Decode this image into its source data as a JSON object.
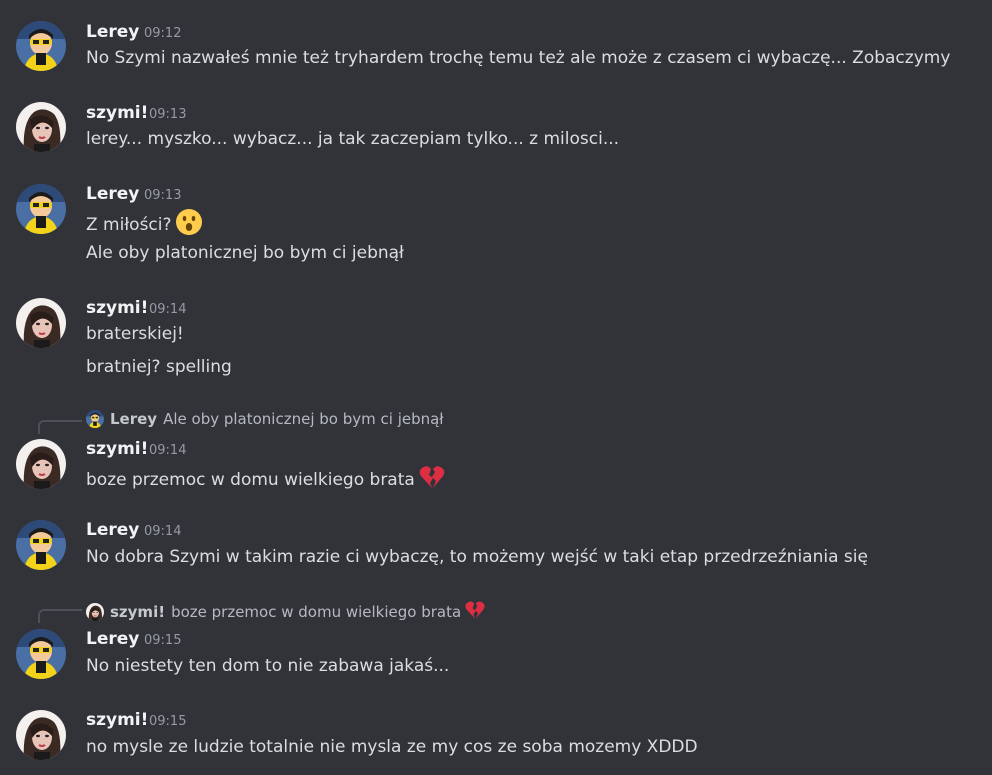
{
  "messages": [
    {
      "author": "Lerey",
      "time": "09:12",
      "avatar": "lerey-avatar",
      "lines": [
        "No Szymi nazwałeś mnie też tryhardem trochę temu też ale może z czasem ci wybaczę... Zobaczymy"
      ]
    },
    {
      "author": "szymi!",
      "time": "09:13",
      "avatar": "szymi-avatar",
      "lines": [
        "lerey... myszko... wybacz... ja tak zaczepiam tylko... z milosci..."
      ]
    },
    {
      "author": "Lerey",
      "time": "09:13",
      "avatar": "lerey-avatar",
      "lines": [
        "Z miłości?",
        "Ale oby platonicznej bo bym ci jebnął"
      ]
    },
    {
      "author": "szymi!",
      "time": "09:14",
      "avatar": "szymi-avatar",
      "lines": [
        "braterskiej!",
        "bratniej? spelling"
      ]
    },
    {
      "author": "szymi!",
      "time": "09:14",
      "avatar": "szymi-avatar",
      "reply": {
        "author": "Lerey",
        "text": "Ale oby platonicznej bo bym ci jebnął"
      },
      "lines": [
        "boze przemoc w domu wielkiego brata"
      ]
    },
    {
      "author": "Lerey",
      "time": "09:14",
      "avatar": "lerey-avatar",
      "lines": [
        "No dobra Szymi w takim razie ci wybaczę, to możemy wejść w taki etap przedrzeźniania się"
      ]
    },
    {
      "author": "Lerey",
      "time": "09:15",
      "avatar": "lerey-avatar",
      "reply": {
        "author": "szymi!",
        "text": "boze przemoc w domu wielkiego brata"
      },
      "lines": [
        "No niestety ten dom to nie zabawa jakaś..."
      ]
    },
    {
      "author": "szymi!",
      "time": "09:15",
      "avatar": "szymi-avatar",
      "lines": [
        "no mysle ze ludzie totalnie nie mysla ze my cos ze soba mozemy XDDD"
      ]
    }
  ],
  "icons": {
    "surprised": "surprised-face-emoji",
    "broken_heart": "broken-heart-emoji"
  },
  "colors": {
    "background": "#313338",
    "author": "#f2f3f5",
    "text": "#dbdee1",
    "timestamp": "#949ba4",
    "emoji_heart": "#dd2e44",
    "emoji_face": "#ffcc4d"
  }
}
